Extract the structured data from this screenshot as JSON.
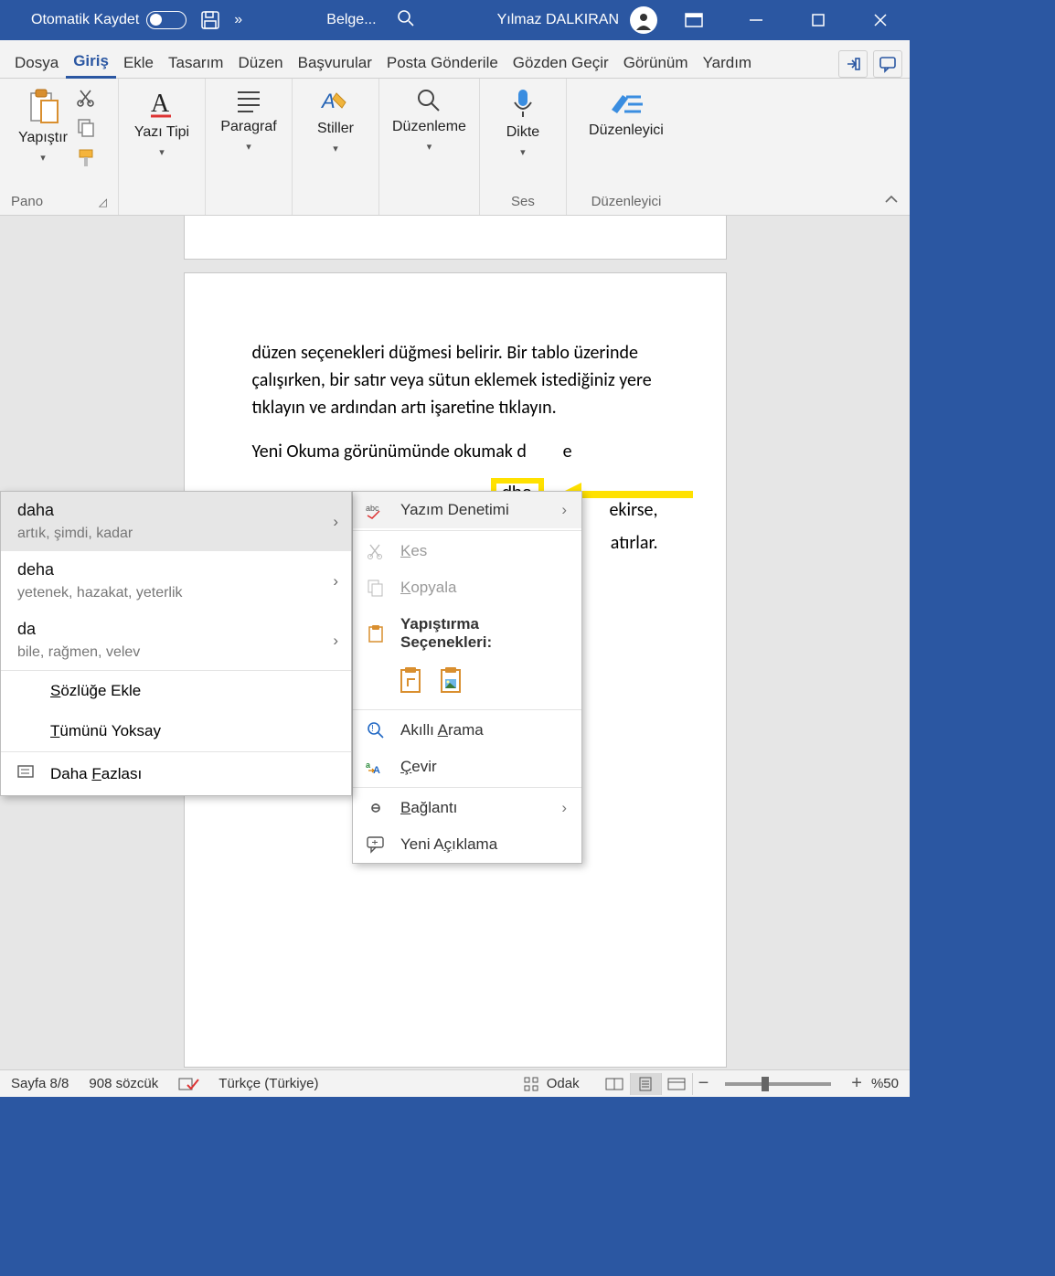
{
  "title_bar": {
    "autosave_label": "Otomatik Kaydet",
    "doc_title": "Belge...",
    "user_name": "Yılmaz DALKIRAN"
  },
  "tabs": [
    "Dosya",
    "Giriş",
    "Ekle",
    "Tasarım",
    "Düzen",
    "Başvurular",
    "Posta Gönderile",
    "Gözden Geçir",
    "Görünüm",
    "Yardım"
  ],
  "active_tab_index": 1,
  "ribbon": {
    "paste": "Yapıştır",
    "pane_pano": "Pano",
    "font": "Yazı Tipi",
    "paragraph": "Paragraf",
    "styles": "Stiller",
    "editing": "Düzenleme",
    "dictate": "Dikte",
    "pane_voice": "Ses",
    "editor": "Düzenleyici",
    "pane_editor": "Düzenleyici"
  },
  "document": {
    "para1": "düzen seçenekleri düğmesi belirir. Bir tablo üzerinde çalışırken, bir satır veya sütun eklemek istediğiniz yere tıklayın ve ardından artı işaretine tıklayın.",
    "para2_pre": "Yeni Okuma görünümünde okumak d",
    "misspelled": "dha",
    "para2_post": "e",
    "frag1": "ekirse,",
    "frag2": "atırlar."
  },
  "context_menu": {
    "spellcheck": "Yazım Denetimi",
    "cut": "Kes",
    "copy": "Kopyala",
    "paste_opts": "Yapıştırma Seçenekleri:",
    "smart_lookup": "Akıllı Arama",
    "translate": "Çevir",
    "link": "Bağlantı",
    "new_comment": "Yeni Açıklama"
  },
  "suggestions": {
    "items": [
      {
        "word": "daha",
        "syn": "artık, şimdi, kadar"
      },
      {
        "word": "deha",
        "syn": "yetenek, hazakat, yeterlik"
      },
      {
        "word": "da",
        "syn": "bile, rağmen, velev"
      }
    ],
    "add_dict": "Sözlüğe Ekle",
    "ignore_all": "Tümünü Yoksay",
    "more": "Daha Fazlası"
  },
  "status": {
    "page": "Sayfa 8/8",
    "words": "908 sözcük",
    "lang": "Türkçe (Türkiye)",
    "focus": "Odak",
    "zoom": "%50"
  }
}
